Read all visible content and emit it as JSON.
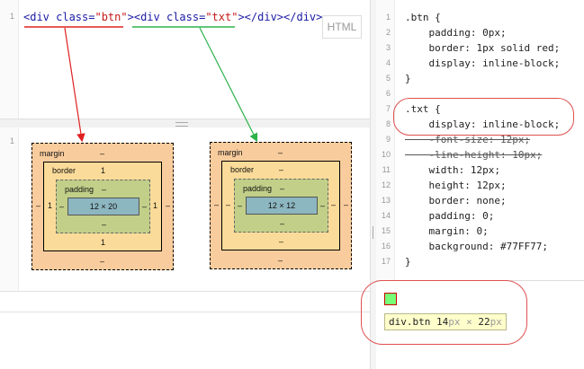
{
  "html_editor": {
    "line_number": "1",
    "code": {
      "open1": "<div ",
      "attr1": "class",
      "eq1": "=",
      "val1": "\"btn\"",
      "close1": ">",
      "open2": "<div ",
      "attr2": "class",
      "eq2": "=",
      "val2": "\"txt\"",
      "close2": "></div></div>"
    },
    "mode_label": "HTML"
  },
  "result": {
    "line_number": "1",
    "boxes": [
      {
        "margin_label": "margin",
        "margin_top": "–",
        "margin_bottom": "–",
        "margin_left": "–",
        "margin_right": "–",
        "border_label": "border",
        "border_top": "1",
        "border_bottom": "1",
        "border_left": "1",
        "border_right": "1",
        "padding_label": "padding",
        "padding_top": "–",
        "padding_bottom": "–",
        "padding_left": "–",
        "padding_right": "–",
        "content": "12 × 20"
      },
      {
        "margin_label": "margin",
        "margin_top": "–",
        "margin_bottom": "–",
        "margin_left": "–",
        "margin_right": "–",
        "border_label": "border",
        "border_top": "–",
        "border_bottom": "–",
        "border_left": "–",
        "border_right": "–",
        "padding_label": "padding",
        "padding_top": "–",
        "padding_bottom": "–",
        "padding_left": "–",
        "padding_right": "–",
        "content": "12 × 12"
      }
    ]
  },
  "css_editor": {
    "line_numbers": [
      "1",
      "2",
      "3",
      "4",
      "5",
      "6",
      "7",
      "8",
      "9",
      "10",
      "11",
      "12",
      "13",
      "14",
      "15",
      "16",
      "17"
    ],
    "lines": [
      ".btn {",
      "    padding: 0px;",
      "    border: 1px solid red;",
      "    display: inline-block;",
      "}",
      "",
      ".txt {",
      "    display: inline-block;",
      "    -font-size: 12px;",
      "    -line-height: 10px;",
      "    width: 12px;",
      "    height: 12px;",
      "    border: none;",
      "    padding: 0;",
      "    margin: 0;",
      "    background: #77FF77;",
      "}"
    ]
  },
  "tooltip": {
    "selector": "div.btn",
    "w": "14",
    "h": "22",
    "unit": "px",
    "times": "×"
  },
  "colors": {
    "annotation_red": "#e05050",
    "arrow_red": "#e02020",
    "arrow_green": "#2cb34a",
    "element_bg": "#77FF77"
  }
}
